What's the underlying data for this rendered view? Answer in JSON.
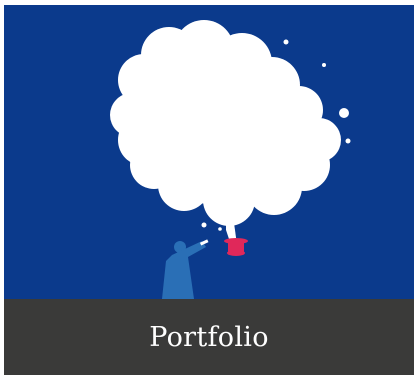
{
  "card": {
    "title": "Portfolio",
    "icon": "thought-cloud-illustration"
  },
  "colors": {
    "background": "#0b3a8c",
    "cloud": "#ffffff",
    "figure": "#2a6fb6",
    "hat": "#e0285a",
    "caption_bar": "#3a3a39",
    "caption_text": "#ffffff"
  }
}
